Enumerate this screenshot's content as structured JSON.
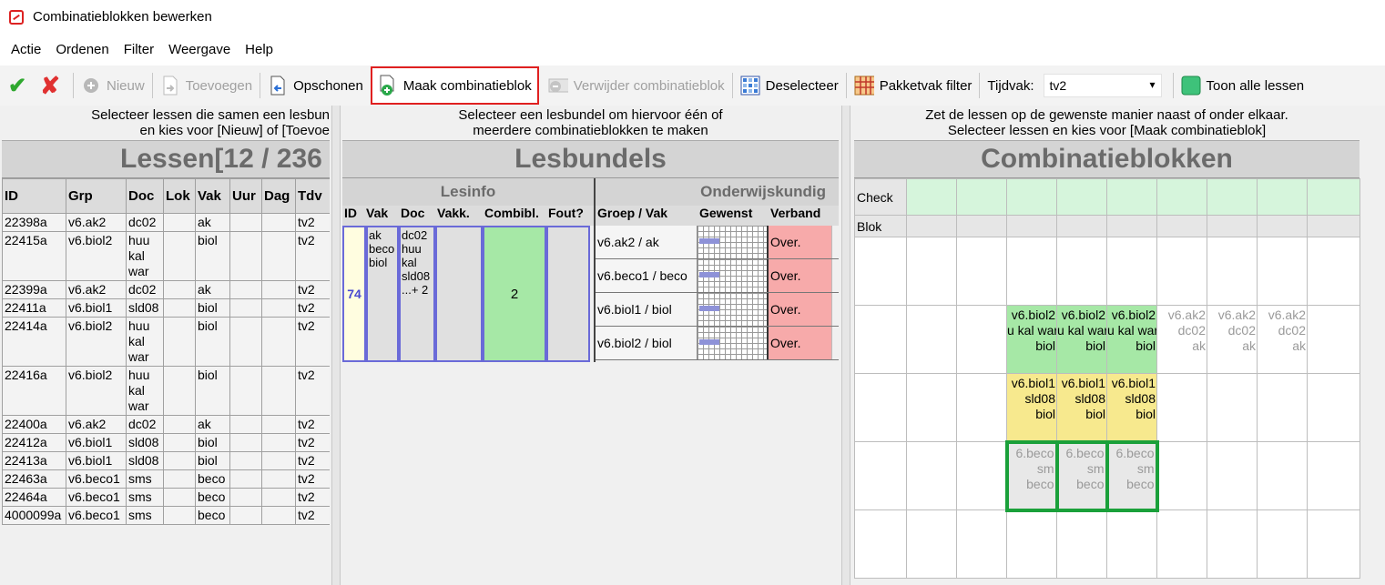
{
  "window": {
    "title": "Combinatieblokken bewerken"
  },
  "menu": [
    "Actie",
    "Ordenen",
    "Filter",
    "Weergave",
    "Help"
  ],
  "toolbar": {
    "nieuw": "Nieuw",
    "toevoegen": "Toevoegen",
    "opschonen": "Opschonen",
    "maak": "Maak combinatieblok",
    "verwijder": "Verwijder combinatieblok",
    "deselecteer": "Deselecteer",
    "pakketvak": "Pakketvak filter",
    "tijdvak_label": "Tijdvak:",
    "tijdvak_value": "tv2",
    "toon": "Toon alle lessen"
  },
  "left": {
    "hint": "Selecteer lessen die samen een lesbun\n en kies voor [Nieuw] of [Toevoe",
    "title": "Lessen[12 / 236",
    "columns": [
      "ID",
      "Grp",
      "Doc",
      "Lok",
      "Vak",
      "Uur",
      "Dag",
      "Tdv"
    ],
    "rows": [
      {
        "id": "22398a",
        "grp": "v6.ak2",
        "doc": "dc02",
        "vak": "ak",
        "tdv": "tv2"
      },
      {
        "id": "22415a",
        "grp": "v6.biol2",
        "doc": "huu\nkal\nwar",
        "vak": "biol",
        "tdv": "tv2"
      },
      {
        "id": "22399a",
        "grp": "v6.ak2",
        "doc": "dc02",
        "vak": "ak",
        "tdv": "tv2"
      },
      {
        "id": "22411a",
        "grp": "v6.biol1",
        "doc": "sld08",
        "vak": "biol",
        "tdv": "tv2"
      },
      {
        "id": "22414a",
        "grp": "v6.biol2",
        "doc": "huu\nkal\nwar",
        "vak": "biol",
        "tdv": "tv2"
      },
      {
        "id": "22416a",
        "grp": "v6.biol2",
        "doc": "huu\nkal\nwar",
        "vak": "biol",
        "tdv": "tv2"
      },
      {
        "id": "22400a",
        "grp": "v6.ak2",
        "doc": "dc02",
        "vak": "ak",
        "tdv": "tv2"
      },
      {
        "id": "22412a",
        "grp": "v6.biol1",
        "doc": "sld08",
        "vak": "biol",
        "tdv": "tv2"
      },
      {
        "id": "22413a",
        "grp": "v6.biol1",
        "doc": "sld08",
        "vak": "biol",
        "tdv": "tv2"
      },
      {
        "id": "22463a",
        "grp": "v6.beco1",
        "doc": "sms",
        "vak": "beco",
        "tdv": "tv2"
      },
      {
        "id": "22464a",
        "grp": "v6.beco1",
        "doc": "sms",
        "vak": "beco",
        "tdv": "tv2"
      },
      {
        "id": "4000099a",
        "grp": "v6.beco1",
        "doc": "sms",
        "vak": "beco",
        "tdv": "tv2"
      }
    ]
  },
  "mid": {
    "hint": "Selecteer een lesbundel om hiervoor één of\nmeerdere combinatieblokken te maken",
    "title": "Lesbundels",
    "lesinfo": "Lesinfo",
    "onderwijskundig": "Onderwijskundig",
    "columns": [
      "ID",
      "Vak",
      "Doc",
      "Vakk.",
      "Combibl.",
      "Fout?",
      "Groep / Vak",
      "Gewenst",
      "Verband"
    ],
    "bundle": {
      "id": "74",
      "vak": "ak\nbeco\nbiol",
      "doc": "dc02\nhuu\nkal\nsld08\n...+ 2",
      "combibl": "2",
      "groups": [
        "v6.ak2 / ak",
        "v6.beco1 / beco",
        "v6.biol1 / biol",
        "v6.biol2 / biol"
      ],
      "verband": [
        "Over.",
        "Over.",
        "Over.",
        "Over."
      ]
    }
  },
  "right": {
    "hint": "Zet de lessen op de gewenste manier naast of onder elkaar.\nSelecteer lessen en kies voor [Maak combinatieblok]",
    "title": "Combinatieblokken",
    "check_label": "Check",
    "blok_label": "Blok",
    "cells": {
      "biol2": "v6.biol2\nu kal war\nbiol",
      "ak2": "v6.ak2\ndc02\nak",
      "biol1": "v6.biol1\nsld08\nbiol",
      "beco": "6.beco\nsm\nbeco"
    }
  },
  "colors": {
    "highlight": "#e02020",
    "green": "#a6e8a6",
    "yellow": "#f7e98e",
    "red": "#f7aaaa",
    "check": "#d6f5dc"
  }
}
